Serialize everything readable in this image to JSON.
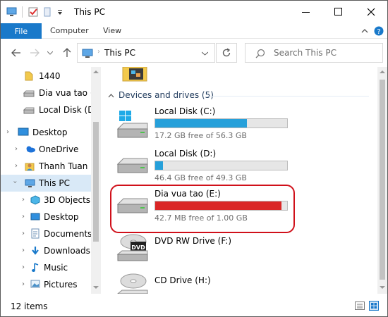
{
  "window": {
    "title": "This PC"
  },
  "ribbon": {
    "file": "File",
    "computer": "Computer",
    "view": "View"
  },
  "address": {
    "location": "This PC"
  },
  "search": {
    "placeholder": "Search This PC"
  },
  "nav": {
    "items": [
      {
        "label": "1440"
      },
      {
        "label": "Dia vua tao (E"
      },
      {
        "label": "Local Disk (D:)"
      },
      {
        "label": "Desktop"
      },
      {
        "label": "OneDrive"
      },
      {
        "label": "Thanh Tuan"
      },
      {
        "label": "This PC"
      },
      {
        "label": "3D Objects"
      },
      {
        "label": "Desktop"
      },
      {
        "label": "Documents"
      },
      {
        "label": "Downloads"
      },
      {
        "label": "Music"
      },
      {
        "label": "Pictures"
      }
    ]
  },
  "content": {
    "group_title": "Devices and drives (5)",
    "drives": [
      {
        "name": "Local Disk (C:)",
        "free_text": "17.2 GB free of 56.3 GB",
        "used_fraction": 0.695,
        "bar_color": "#26a0da"
      },
      {
        "name": "Local Disk (D:)",
        "free_text": "46.4 GB free of 49.3 GB",
        "used_fraction": 0.059,
        "bar_color": "#26a0da"
      },
      {
        "name": "Dia vua tao (E:)",
        "free_text": "42.7 MB free of 1.00 GB",
        "used_fraction": 0.958,
        "bar_color": "#da2626"
      },
      {
        "name": "DVD RW Drive (F:)"
      },
      {
        "name": "CD Drive (H:)"
      }
    ]
  },
  "status": {
    "items_count": "12 items"
  },
  "colors": {
    "accent": "#1979ca",
    "highlight": "#d0101a",
    "selection": "#d9e9f7"
  }
}
